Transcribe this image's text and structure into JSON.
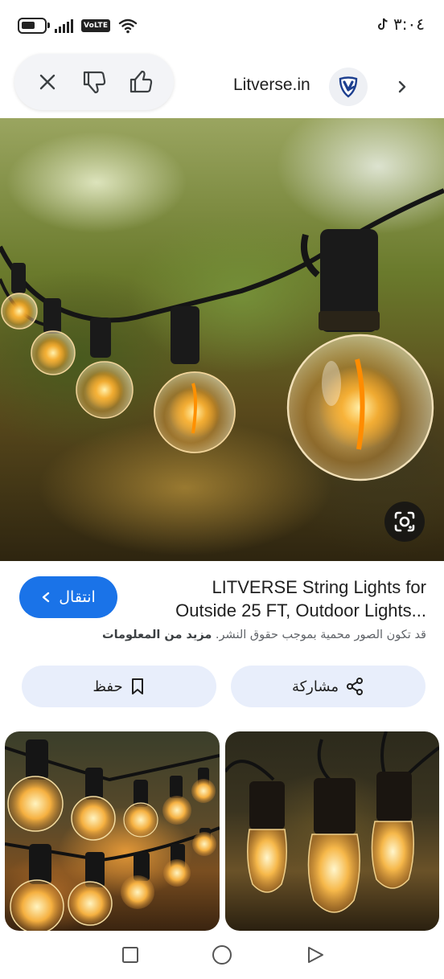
{
  "status_bar": {
    "time": "٣:٠٤",
    "volte_label": "VoLTE"
  },
  "header": {
    "site_name": "Litverse.in"
  },
  "result": {
    "title_line1": "LITVERSE String Lights for",
    "title_line2": "Outside 25 FT, Outdoor Lights...",
    "visit_label": "انتقال",
    "copyright_text": "قد تكون الصور محمية بموجب حقوق النشر.",
    "learn_more_label": "مزيد من المعلومات"
  },
  "actions": {
    "share_label": "مشاركة",
    "save_label": "حفظ"
  },
  "icons": {
    "close": "close-icon",
    "dislike": "thumbs-down-icon",
    "like": "thumbs-up-icon",
    "site_logo": "shield-logo-icon",
    "next": "chevron-right-icon",
    "lens": "lens-icon",
    "share": "share-icon",
    "bookmark": "bookmark-icon",
    "nav_recents": "square-icon",
    "nav_home": "circle-icon",
    "nav_back": "triangle-icon"
  },
  "colors": {
    "accent": "#1a73e8",
    "chip_bg": "#e8eefb",
    "logo_blue": "#1d3f8f"
  }
}
